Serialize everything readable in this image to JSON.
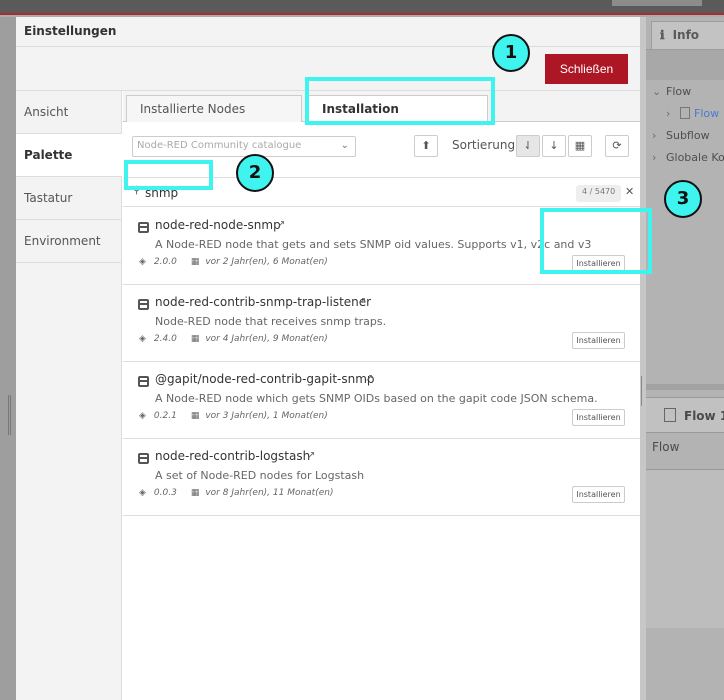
{
  "dialog": {
    "title": "Einstellungen",
    "close_label": "Schließen",
    "side_tabs": [
      {
        "label": "Ansicht"
      },
      {
        "label": "Palette"
      },
      {
        "label": "Tastatur"
      },
      {
        "label": "Environment"
      }
    ],
    "pane_tabs": [
      {
        "label": "Installierte Nodes"
      },
      {
        "label": "Installation"
      }
    ],
    "catalog_select": "Node-RED Community catalogue",
    "sort_label": "Sortierung:",
    "search_value": "snmp",
    "result_count": "4 / 5470",
    "install_label": "Installieren",
    "packages": [
      {
        "name": "node-red-node-snmp",
        "description": "A Node-RED node that gets and sets SNMP oid values. Supports v1, v2c and v3",
        "version": "2.0.0",
        "updated": "vor 2 Jahr(en), 6 Monat(en)"
      },
      {
        "name": "node-red-contrib-snmp-trap-listener",
        "description": "Node-RED node that receives snmp traps.",
        "version": "2.4.0",
        "updated": "vor 4 Jahr(en), 9 Monat(en)"
      },
      {
        "name": "@gapit/node-red-contrib-gapit-snmp",
        "description": "A Node-RED node which gets SNMP OIDs based on the gapit code JSON schema.",
        "version": "0.2.1",
        "updated": "vor 3 Jahr(en), 1 Monat(en)"
      },
      {
        "name": "node-red-contrib-logstash",
        "description": "A set of Node-RED nodes for Logstash",
        "version": "0.0.3",
        "updated": "vor 8 Jahr(en), 11 Monat(en)"
      }
    ]
  },
  "info_panel": {
    "tab_label": "Info",
    "tree": [
      {
        "label": "Flow"
      },
      {
        "label": "Flow"
      },
      {
        "label": "Subflow"
      },
      {
        "label": "Globale Ko"
      }
    ],
    "section_title": "Flow 1",
    "flow_label": "Flow"
  },
  "annotations": [
    "1",
    "2",
    "3"
  ],
  "colors": {
    "accent_red": "#ad1625",
    "highlight": "#3ff3ee"
  }
}
